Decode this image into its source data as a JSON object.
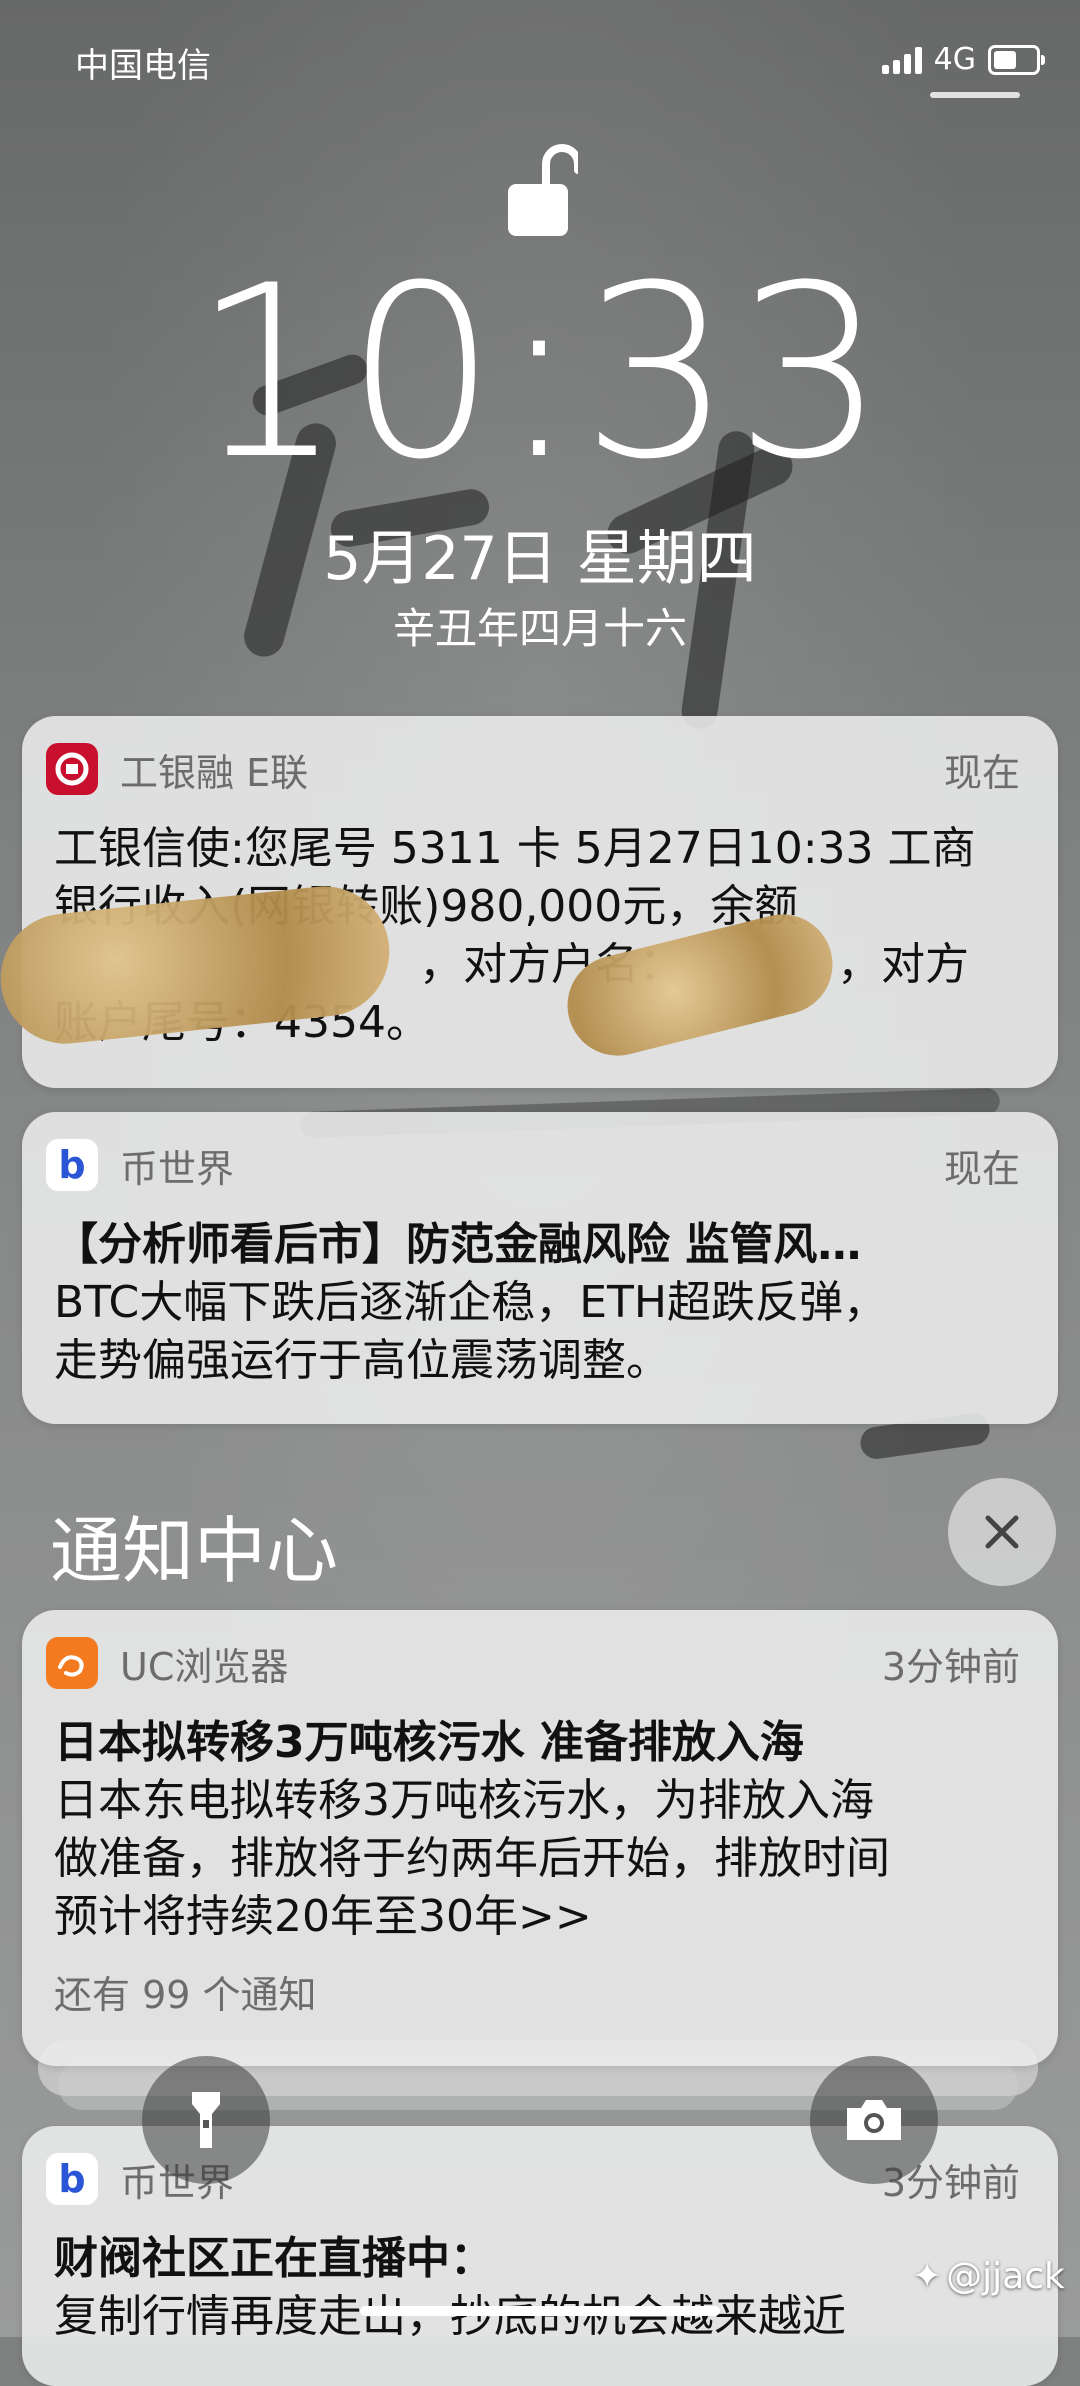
{
  "status_bar": {
    "carrier": "中国电信",
    "network": "4G"
  },
  "lock": {
    "time": "10:33",
    "date": "5月27日 星期四",
    "lunar_date": "辛丑年四月十六"
  },
  "notifications": [
    {
      "app": "工银融 E联",
      "time": "现在",
      "body_lines": [
        "工银信使:您尾号 5311 卡 5月27日10:33 工商",
        "银行收入(网银转账)980,000元，余额",
        "，对方户名：　　　　，对方",
        "账户尾号：4354。"
      ]
    },
    {
      "app": "币世界",
      "time": "现在",
      "title": "【分析师看后市】防范金融风险 监管风…",
      "body_lines": [
        "BTC大幅下跌后逐渐企稳，ETH超跌反弹，",
        "走势偏强运行于高位震荡调整。"
      ]
    }
  ],
  "notification_center": {
    "title": "通知中心",
    "items": [
      {
        "app": "UC浏览器",
        "time": "3分钟前",
        "title": "日本拟转移3万吨核污水 准备排放入海",
        "body_lines": [
          "日本东电拟转移3万吨核污水，为排放入海",
          "做准备，排放将于约两年后开始，排放时间",
          "预计将持续20年至30年>>"
        ],
        "more": "还有 99 个通知"
      },
      {
        "app": "币世界",
        "time": "3分钟前",
        "title": "财阀社区正在直播中：",
        "body_lines": [
          "复制行情再度走出，抄底的机会越来越近"
        ]
      }
    ]
  },
  "watermark": "@jjack",
  "colors": {
    "icbc_red": "#c8102e",
    "uc_orange": "#f47a20",
    "bishijie_blue": "#2a56d6"
  }
}
